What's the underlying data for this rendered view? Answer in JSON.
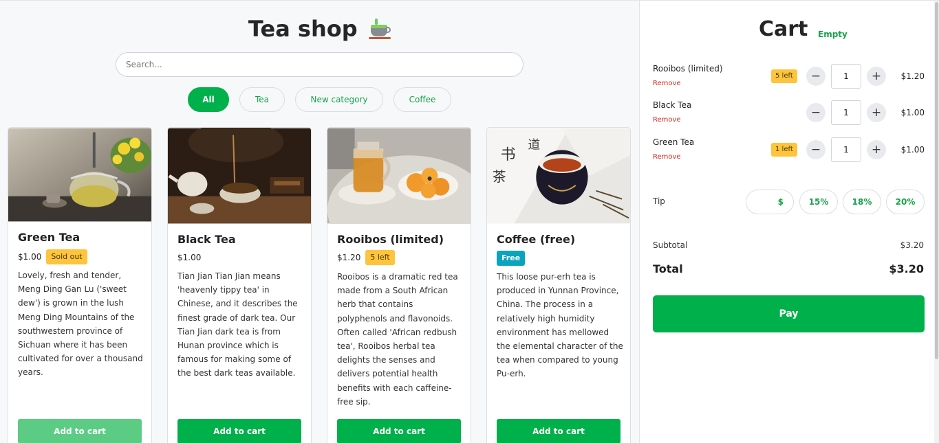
{
  "shop": {
    "title": "Tea shop",
    "search_placeholder": "Search...",
    "categories": [
      {
        "label": "All",
        "active": true
      },
      {
        "label": "Tea",
        "active": false
      },
      {
        "label": "New category",
        "active": false
      },
      {
        "label": "Coffee",
        "active": false
      }
    ],
    "products": [
      {
        "name": "Green Tea",
        "price": "$1.00",
        "badge": "Sold out",
        "description": "Lovely, fresh and tender, Meng Ding Gan Lu ('sweet dew') is grown in the lush Meng Ding Mountains of the southwestern province of Sichuan where it has been cultivated for over a thousand years.",
        "button": "Add to cart",
        "disabled": true
      },
      {
        "name": "Black Tea",
        "price": "$1.00",
        "badge": "",
        "description": "Tian Jian Tian Jian means 'heavenly tippy tea' in Chinese, and it describes the finest grade of dark tea. Our Tian Jian dark tea is from Hunan province which is famous for making some of the best dark teas available.",
        "button": "Add to cart",
        "disabled": false
      },
      {
        "name": "Rooibos (limited)",
        "price": "$1.20",
        "badge": "5 left",
        "description": "Rooibos is a dramatic red tea made from a South African herb that contains polyphenols and flavonoids. Often called 'African redbush tea', Rooibos herbal tea delights the senses and delivers potential health benefits with each caffeine-free sip.",
        "button": "Add to cart",
        "disabled": false
      },
      {
        "name": "Coffee (free)",
        "price": "",
        "badge": "Free",
        "description": "This loose pur-erh tea is produced in Yunnan Province, China. The process in a relatively high humidity environment has mellowed the elemental character of the tea when compared to young Pu-erh.",
        "button": "Add to cart",
        "disabled": false
      }
    ]
  },
  "cart": {
    "title": "Cart",
    "status": "Empty",
    "items": [
      {
        "name": "Rooibos (limited)",
        "remove": "Remove",
        "stock": "5 left",
        "qty": "1",
        "price": "$1.20"
      },
      {
        "name": "Black Tea",
        "remove": "Remove",
        "stock": "",
        "qty": "1",
        "price": "$1.00"
      },
      {
        "name": "Green Tea",
        "remove": "Remove",
        "stock": "1 left",
        "qty": "1",
        "price": "$1.00"
      }
    ],
    "tip_label": "Tip",
    "tip_custom": "$",
    "tip_options": [
      "15%",
      "18%",
      "20%"
    ],
    "subtotal_label": "Subtotal",
    "subtotal": "$3.20",
    "total_label": "Total",
    "total": "$3.20",
    "pay_label": "Pay"
  },
  "colors": {
    "accent": "#00b04a",
    "warning": "#ffc43d",
    "info": "#0ba4bd",
    "danger": "#d9251c"
  },
  "icons": [
    "tea-cup-icon",
    "minus-icon",
    "plus-icon"
  ]
}
